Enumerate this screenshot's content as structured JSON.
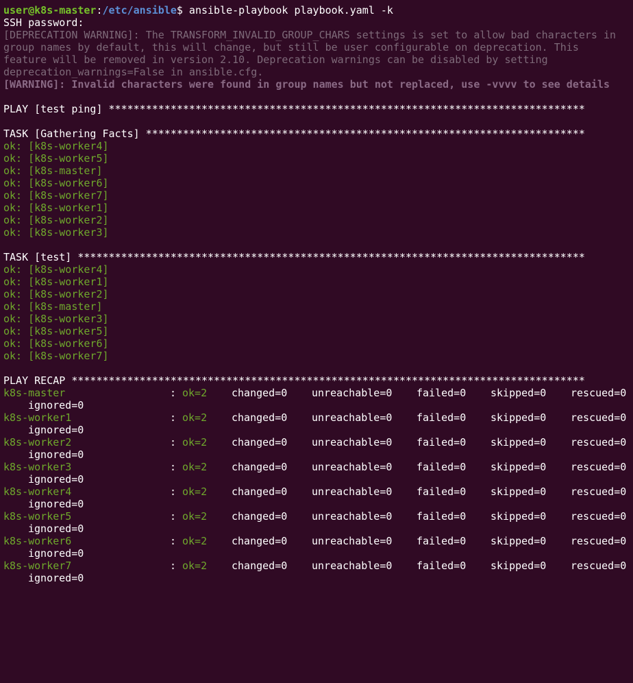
{
  "prompt": {
    "user_host": "user@k8s-master",
    "colon": ":",
    "path": "/etc/ansible",
    "symbol": "$",
    "command": " ansible-playbook playbook.yaml -k"
  },
  "ssh_prompt": "SSH password:",
  "deprecation": [
    "[DEPRECATION WARNING]: The TRANSFORM_INVALID_GROUP_CHARS settings is set to allow bad characters in",
    "group names by default, this will change, but still be user configurable on deprecation. This",
    "feature will be removed in version 2.10. Deprecation warnings can be disabled by setting",
    "deprecation_warnings=False in ansible.cfg."
  ],
  "warning": "[WARNING]: Invalid characters were found in group names but not replaced, use -vvvv to see details",
  "play_header": "PLAY [test ping] *****************************************************************************",
  "task1_header": "TASK [Gathering Facts] ***********************************************************************",
  "task1_results": [
    "ok: [k8s-worker4]",
    "ok: [k8s-worker5]",
    "ok: [k8s-master]",
    "ok: [k8s-worker6]",
    "ok: [k8s-worker7]",
    "ok: [k8s-worker1]",
    "ok: [k8s-worker2]",
    "ok: [k8s-worker3]"
  ],
  "task2_header": "TASK [test] **********************************************************************************",
  "task2_results": [
    "ok: [k8s-worker4]",
    "ok: [k8s-worker1]",
    "ok: [k8s-worker2]",
    "ok: [k8s-master]",
    "ok: [k8s-worker3]",
    "ok: [k8s-worker5]",
    "ok: [k8s-worker6]",
    "ok: [k8s-worker7]"
  ],
  "recap_header": "PLAY RECAP ***********************************************************************************",
  "recap": [
    {
      "host": "k8s-master",
      "colon": ":",
      "ok": "ok=2",
      "changed": "changed=0",
      "unreachable": "unreachable=0",
      "failed": "failed=0",
      "skipped": "skipped=0",
      "rescued": "rescued=0",
      "ignored": "ignored=0"
    },
    {
      "host": "k8s-worker1",
      "colon": ":",
      "ok": "ok=2",
      "changed": "changed=0",
      "unreachable": "unreachable=0",
      "failed": "failed=0",
      "skipped": "skipped=0",
      "rescued": "rescued=0",
      "ignored": "ignored=0"
    },
    {
      "host": "k8s-worker2",
      "colon": ":",
      "ok": "ok=2",
      "changed": "changed=0",
      "unreachable": "unreachable=0",
      "failed": "failed=0",
      "skipped": "skipped=0",
      "rescued": "rescued=0",
      "ignored": "ignored=0"
    },
    {
      "host": "k8s-worker3",
      "colon": ":",
      "ok": "ok=2",
      "changed": "changed=0",
      "unreachable": "unreachable=0",
      "failed": "failed=0",
      "skipped": "skipped=0",
      "rescued": "rescued=0",
      "ignored": "ignored=0"
    },
    {
      "host": "k8s-worker4",
      "colon": ":",
      "ok": "ok=2",
      "changed": "changed=0",
      "unreachable": "unreachable=0",
      "failed": "failed=0",
      "skipped": "skipped=0",
      "rescued": "rescued=0",
      "ignored": "ignored=0"
    },
    {
      "host": "k8s-worker5",
      "colon": ":",
      "ok": "ok=2",
      "changed": "changed=0",
      "unreachable": "unreachable=0",
      "failed": "failed=0",
      "skipped": "skipped=0",
      "rescued": "rescued=0",
      "ignored": "ignored=0"
    },
    {
      "host": "k8s-worker6",
      "colon": ":",
      "ok": "ok=2",
      "changed": "changed=0",
      "unreachable": "unreachable=0",
      "failed": "failed=0",
      "skipped": "skipped=0",
      "rescued": "rescued=0",
      "ignored": "ignored=0"
    },
    {
      "host": "k8s-worker7",
      "colon": ":",
      "ok": "ok=2",
      "changed": "changed=0",
      "unreachable": "unreachable=0",
      "failed": "failed=0",
      "skipped": "skipped=0",
      "rescued": "rescued=0",
      "ignored": "ignored=0"
    }
  ],
  "colors": {
    "background": "#300a24",
    "ok_green": "#6fa82c",
    "prompt_green": "#76c22a",
    "prompt_blue": "#5c8fd6",
    "warning_gray": "#7e6a79"
  }
}
